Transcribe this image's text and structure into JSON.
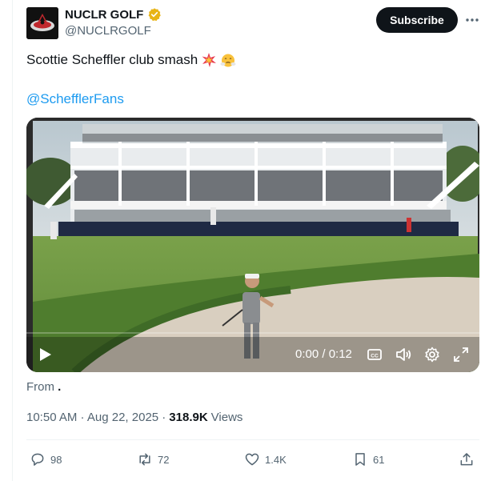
{
  "author": {
    "display_name": "NUCLR GOLF",
    "handle": "@NUCLRGOLF",
    "verified": true,
    "verified_badge_color": "#e8b416"
  },
  "header": {
    "subscribe_label": "Subscribe",
    "more_icon": "more-horizontal-icon"
  },
  "tweet": {
    "text": "Scottie Scheffler club smash",
    "emojis": [
      "collision-emoji",
      "face-with-steam-emoji"
    ],
    "mention": "@SchefflerFans"
  },
  "video": {
    "time_display": "0:00 / 0:12",
    "progress": 0,
    "icons": [
      "play-icon",
      "captions-icon",
      "volume-icon",
      "settings-icon",
      "fullscreen-icon"
    ]
  },
  "source": {
    "from_label": "From",
    "from_value": "."
  },
  "meta": {
    "timestamp": "10:50 AM · Aug 22, 2025 ·",
    "views_count": "318.9K",
    "views_label": "Views"
  },
  "actions": {
    "replies": "98",
    "reposts": "72",
    "likes": "1.4K",
    "bookmarks": "61"
  },
  "colors": {
    "link": "#1d9bf0",
    "text": "#0f1419",
    "muted": "#536471",
    "button_bg": "#0f1419"
  }
}
